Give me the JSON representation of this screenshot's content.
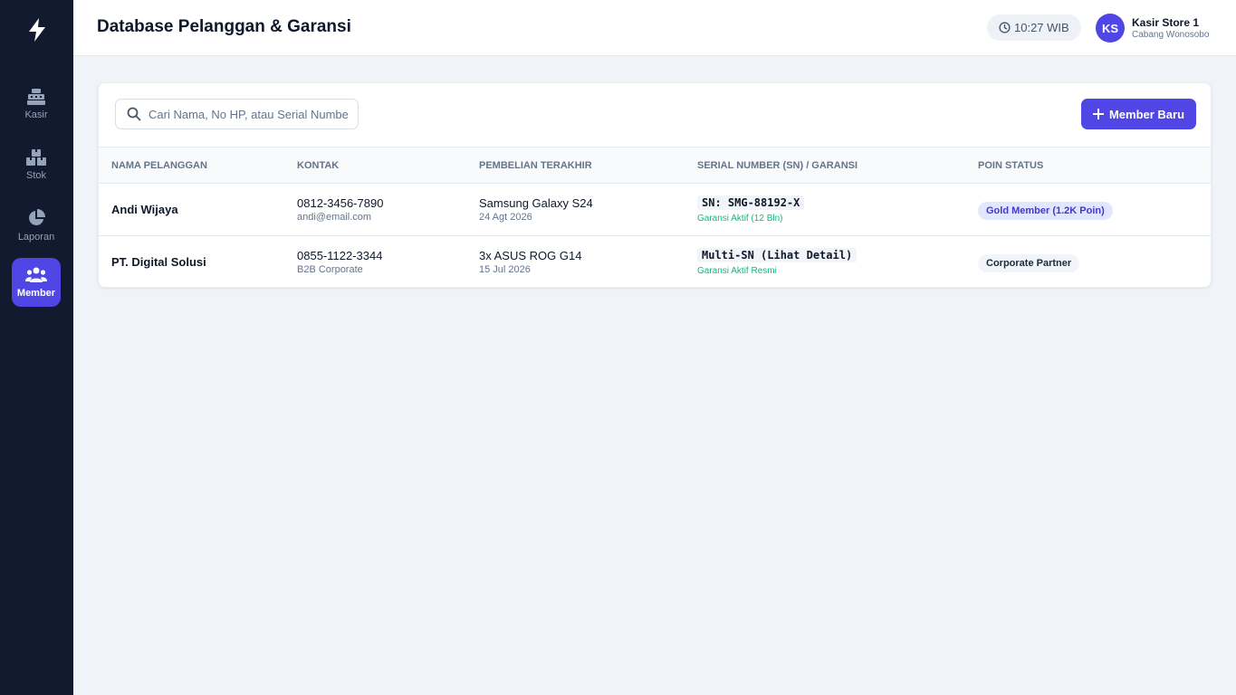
{
  "app": {
    "logo_icon": "lightning-bolt-icon",
    "accent_color": "#4f46e5",
    "sidebar_color": "#111a2e"
  },
  "sidebar": {
    "items": [
      {
        "label": "Kasir",
        "icon": "cash-register-icon",
        "active": false
      },
      {
        "label": "Stok",
        "icon": "boxes-icon",
        "active": false
      },
      {
        "label": "Laporan",
        "icon": "pie-chart-icon",
        "active": false
      },
      {
        "label": "Member",
        "icon": "users-icon",
        "active": true
      }
    ]
  },
  "header": {
    "title": "Database Pelanggan & Garansi",
    "clock": "10:27 WIB",
    "user": {
      "initials": "KS",
      "name": "Kasir Store 1",
      "branch": "Cabang Wonosobo"
    }
  },
  "toolbar": {
    "search_placeholder": "Cari Nama, No HP, atau Serial Number",
    "search_value": "",
    "add_label": "Member Baru"
  },
  "table": {
    "columns": [
      "NAMA PELANGGAN",
      "KONTAK",
      "PEMBELIAN TERAKHIR",
      "SERIAL NUMBER (SN) / GARANSI",
      "POIN STATUS"
    ],
    "rows": [
      {
        "name": "Andi Wijaya",
        "phone": "0812-3456-7890",
        "contact_sub": "andi@email.com",
        "product": "Samsung Galaxy S24",
        "date": "24 Agt 2026",
        "sn": "SN: SMG-88192-X",
        "warranty": "Garansi Aktif (12 Bln)",
        "status": "Gold Member (1.2K Poin)"
      },
      {
        "name": "PT. Digital Solusi",
        "phone": "0855-1122-3344",
        "contact_sub": "B2B Corporate",
        "product": "3x ASUS ROG G14",
        "date": "15 Jul 2026",
        "sn": "Multi-SN (Lihat Detail)",
        "warranty": "Garansi Aktif Resmi",
        "status": "Corporate Partner"
      }
    ]
  }
}
